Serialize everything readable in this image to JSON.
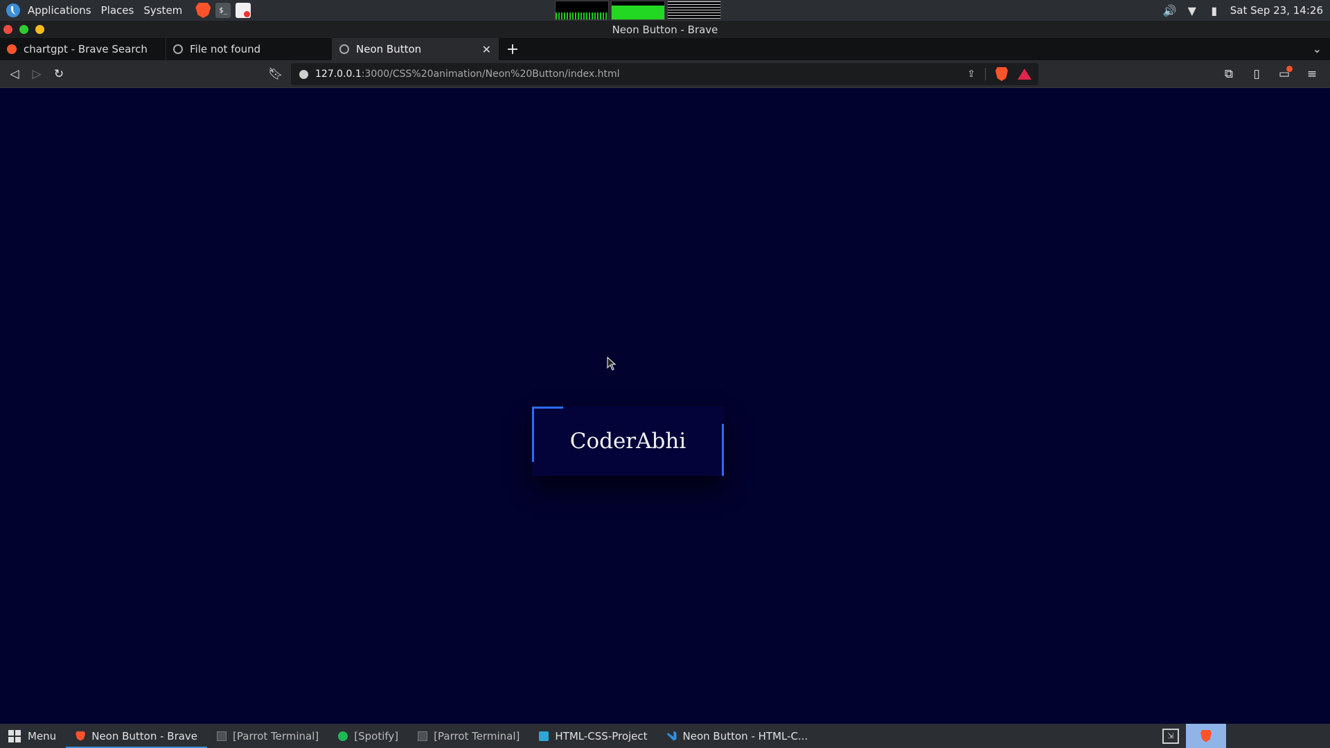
{
  "system_panel": {
    "menus": [
      "Applications",
      "Places",
      "System"
    ],
    "clock": "Sat Sep 23, 14:26"
  },
  "window": {
    "title": "Neon Button - Brave"
  },
  "tabs": [
    {
      "label": "chartgpt - Brave Search",
      "favicon": "brave-search-icon"
    },
    {
      "label": "File not found",
      "favicon": "globe-icon"
    },
    {
      "label": "Neon Button",
      "favicon": "globe-icon",
      "active": true
    }
  ],
  "toolbar": {
    "url_host": "127.0.0.1",
    "url_path": ":3000/CSS%20animation/Neon%20Button/index.html"
  },
  "page": {
    "button_label": "CoderAbhi",
    "colors": {
      "background": "#02022e",
      "button": "#03033a",
      "neon": "#2c6cf5"
    }
  },
  "taskbar": {
    "menu_label": "Menu",
    "items": [
      {
        "label": "Neon Button - Brave",
        "icon": "brave-icon",
        "active": true
      },
      {
        "label": "[Parrot Terminal]",
        "icon": "terminal-icon"
      },
      {
        "label": "[Spotify]",
        "icon": "spotify-icon"
      },
      {
        "label": "[Parrot Terminal]",
        "icon": "terminal-icon"
      },
      {
        "label": "HTML-CSS-Project",
        "icon": "folder-icon"
      },
      {
        "label": "Neon Button - HTML-C...",
        "icon": "vscode-icon"
      }
    ]
  }
}
